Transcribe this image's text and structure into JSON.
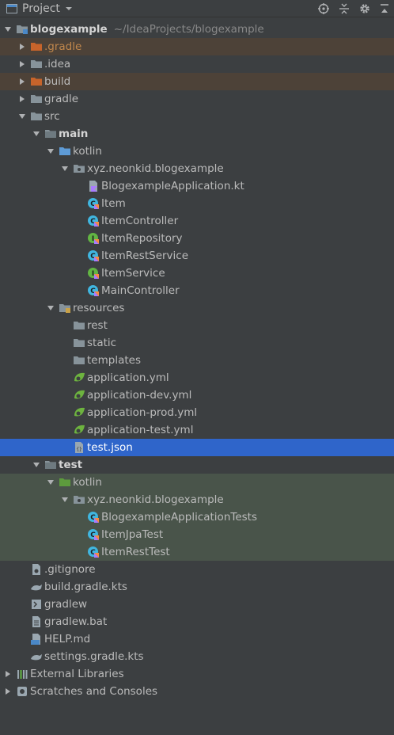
{
  "header": {
    "title": "Project",
    "icons": [
      "project-window-icon",
      "chevron-down-icon",
      "locate-icon",
      "collapse-icon",
      "gear-icon",
      "hide-icon"
    ]
  },
  "colors": {
    "background": "#3c3f41",
    "selection": "#2f65ca",
    "excluded_row": "#4d4238",
    "test_row": "#49544a",
    "folder_blue": "#5e9bd6",
    "folder_orange": "#c7642b",
    "folder_green": "#5d9b3d"
  },
  "tree": [
    {
      "label": "blogexample",
      "path": "~/IdeaProjects/blogexample",
      "arrow": "down",
      "icon": "module-folder",
      "bold": true
    },
    {
      "label": ".gradle",
      "arrow": "right",
      "icon": "folder-orange",
      "bg": "excl",
      "orange": true
    },
    {
      "label": ".idea",
      "arrow": "right",
      "icon": "folder"
    },
    {
      "label": "build",
      "arrow": "right",
      "icon": "folder-orange",
      "bg": "excl"
    },
    {
      "label": "gradle",
      "arrow": "right",
      "icon": "folder"
    },
    {
      "label": "src",
      "arrow": "down",
      "icon": "folder"
    },
    {
      "label": "main",
      "arrow": "down",
      "icon": "folder-dark",
      "bold": true
    },
    {
      "label": "kotlin",
      "arrow": "down",
      "icon": "folder-blue"
    },
    {
      "label": "xyz.neonkid.blogexample",
      "arrow": "down",
      "icon": "package"
    },
    {
      "label": "BlogexampleApplication.kt",
      "icon": "kotlin-file"
    },
    {
      "label": "Item",
      "icon": "kotlin-class"
    },
    {
      "label": "ItemController",
      "icon": "kotlin-class"
    },
    {
      "label": "ItemRepository",
      "icon": "kotlin-interface"
    },
    {
      "label": "ItemRestService",
      "icon": "kotlin-class"
    },
    {
      "label": "ItemService",
      "icon": "kotlin-interface"
    },
    {
      "label": "MainController",
      "icon": "kotlin-class"
    },
    {
      "label": "resources",
      "arrow": "down",
      "icon": "resources-folder"
    },
    {
      "label": "rest",
      "icon": "folder"
    },
    {
      "label": "static",
      "icon": "folder"
    },
    {
      "label": "templates",
      "icon": "folder"
    },
    {
      "label": "application.yml",
      "icon": "spring-yml"
    },
    {
      "label": "application-dev.yml",
      "icon": "spring-yml"
    },
    {
      "label": "application-prod.yml",
      "icon": "spring-yml"
    },
    {
      "label": "application-test.yml",
      "icon": "spring-yml"
    },
    {
      "label": "test.json",
      "icon": "json-file",
      "selected": true
    },
    {
      "label": "test",
      "arrow": "down",
      "icon": "folder-dark",
      "bold": true
    },
    {
      "label": "kotlin",
      "arrow": "down",
      "icon": "folder-green",
      "bg": "test"
    },
    {
      "label": "xyz.neonkid.blogexample",
      "arrow": "down",
      "icon": "package",
      "bg": "test"
    },
    {
      "label": "BlogexampleApplicationTests",
      "icon": "kotlin-class",
      "bg": "test"
    },
    {
      "label": "ItemJpaTest",
      "icon": "kotlin-class",
      "bg": "test"
    },
    {
      "label": "ItemRestTest",
      "icon": "kotlin-class",
      "bg": "test"
    },
    {
      "label": ".gitignore",
      "icon": "gitignore-file"
    },
    {
      "label": "build.gradle.kts",
      "icon": "gradle-file"
    },
    {
      "label": "gradlew",
      "icon": "shell-file"
    },
    {
      "label": "gradlew.bat",
      "icon": "text-file"
    },
    {
      "label": "HELP.md",
      "icon": "markdown-file"
    },
    {
      "label": "settings.gradle.kts",
      "icon": "gradle-file"
    },
    {
      "label": "External Libraries",
      "arrow": "right",
      "icon": "libraries"
    },
    {
      "label": "Scratches and Consoles",
      "arrow": "right",
      "icon": "scratches"
    }
  ]
}
